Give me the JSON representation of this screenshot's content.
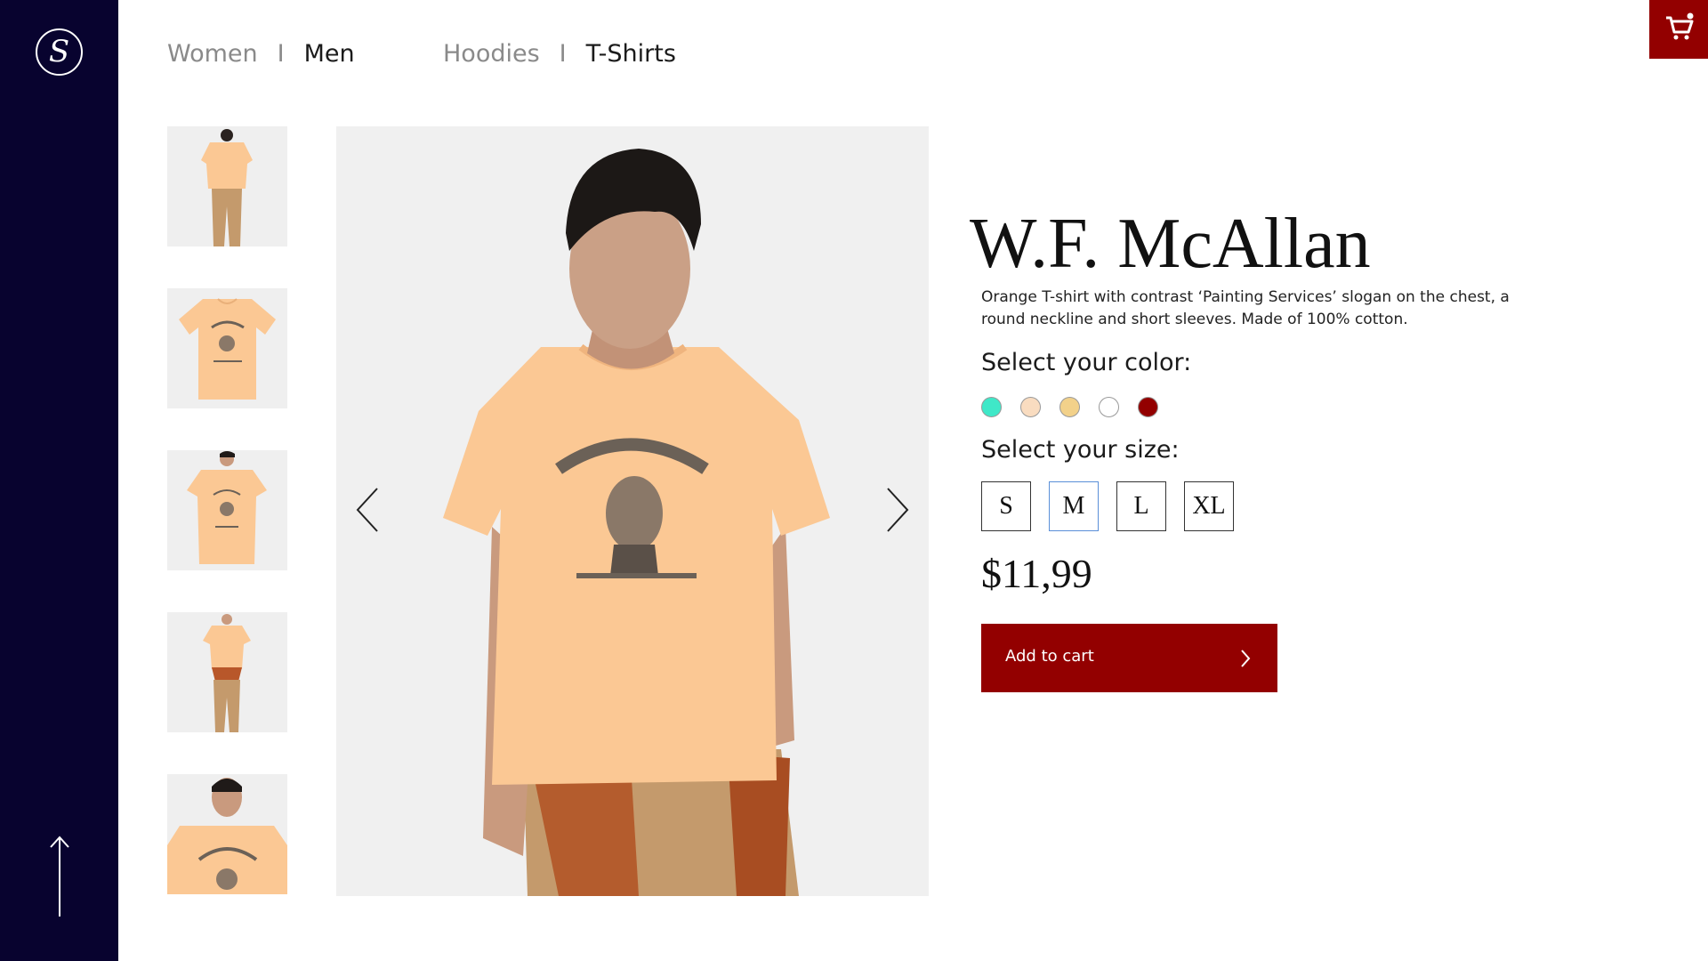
{
  "sidebar": {
    "logo_text": "S",
    "scroll_top_icon": "arrow-up-icon"
  },
  "nav": {
    "gender": [
      {
        "label": "Women",
        "active": false
      },
      {
        "label": "Men",
        "active": true
      }
    ],
    "category": [
      {
        "label": "Hoodies",
        "active": false
      },
      {
        "label": "T-Shirts",
        "active": true
      }
    ],
    "separator": "I"
  },
  "cart": {
    "icon": "cart-icon",
    "color": "#930000"
  },
  "gallery": {
    "thumbnails": [
      "back view",
      "flat lay",
      "front view",
      "full body",
      "close-up"
    ],
    "prev_icon": "chevron-left-icon",
    "next_icon": "chevron-right-icon"
  },
  "product": {
    "title": "W.F. McAllan",
    "description": "Orange T-shirt with contrast ‘Painting Services’ slogan on the chest, a round neckline and short sleeves. Made of 100% cotton.",
    "color_label": "Select your color:",
    "colors": [
      "#3fe8c8",
      "#f9dcc0",
      "#f2d18a",
      "#ffffff",
      "#930000"
    ],
    "size_label": "Select your size:",
    "sizes": [
      "S",
      "M",
      "L",
      "XL"
    ],
    "selected_size": "M",
    "price": "$11,99",
    "add_to_cart_label": "Add to cart"
  },
  "theme": {
    "sidebar_bg": "#08032f",
    "accent": "#930000",
    "shirt": "#fbc894"
  }
}
